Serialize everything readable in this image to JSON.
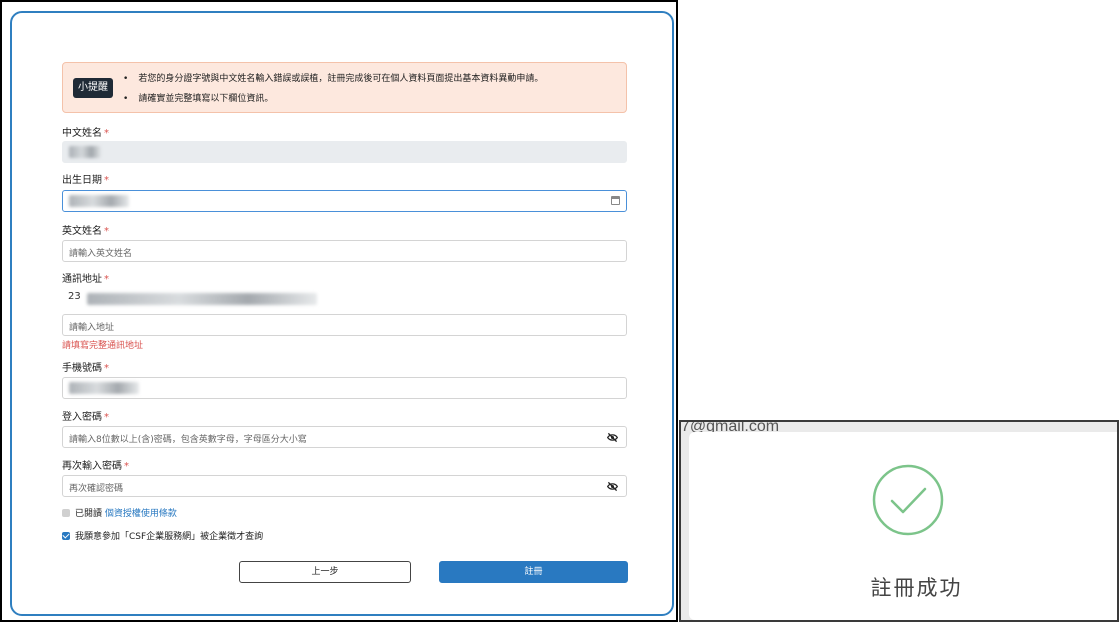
{
  "notice": {
    "badge": "小提醒",
    "items": [
      "若您的身分證字號與中文姓名輸入錯誤或誤植，註冊完成後可在個人資料頁面提出基本資料異動申請。",
      "請確實並完整填寫以下欄位資訊。"
    ]
  },
  "form": {
    "required_mark": "*",
    "chinese_name": {
      "label": "中文姓名"
    },
    "birth_date": {
      "label": "出生日期"
    },
    "english_name": {
      "label": "英文姓名",
      "placeholder": "請輸入英文姓名"
    },
    "address": {
      "label": "通訊地址",
      "value_prefix": "23",
      "placeholder": "請輸入地址",
      "error": "請填寫完整通訊地址"
    },
    "phone": {
      "label": "手機號碼"
    },
    "password": {
      "label": "登入密碼",
      "placeholder": "請輸入8位數以上(含)密碼，包含英數字母，字母區分大小寫"
    },
    "password_confirm": {
      "label": "再次輸入密碼",
      "placeholder": "再次確認密碼"
    },
    "privacy": {
      "prefix": "已閱讀",
      "link": "個資授權使用條款",
      "checked": false
    },
    "join_csf": {
      "label": "我願意參加「CSF企業服務網」被企業徵才查詢",
      "checked": true
    },
    "prev_button": "上一步",
    "submit_button": "註冊"
  },
  "success_modal": {
    "behind_text": "7@gmail.com",
    "title": "註冊成功",
    "accent_color": "#5cb85c"
  },
  "colors": {
    "primary": "#2979c1",
    "error": "#d9534f",
    "notice_bg": "#fde8de"
  }
}
